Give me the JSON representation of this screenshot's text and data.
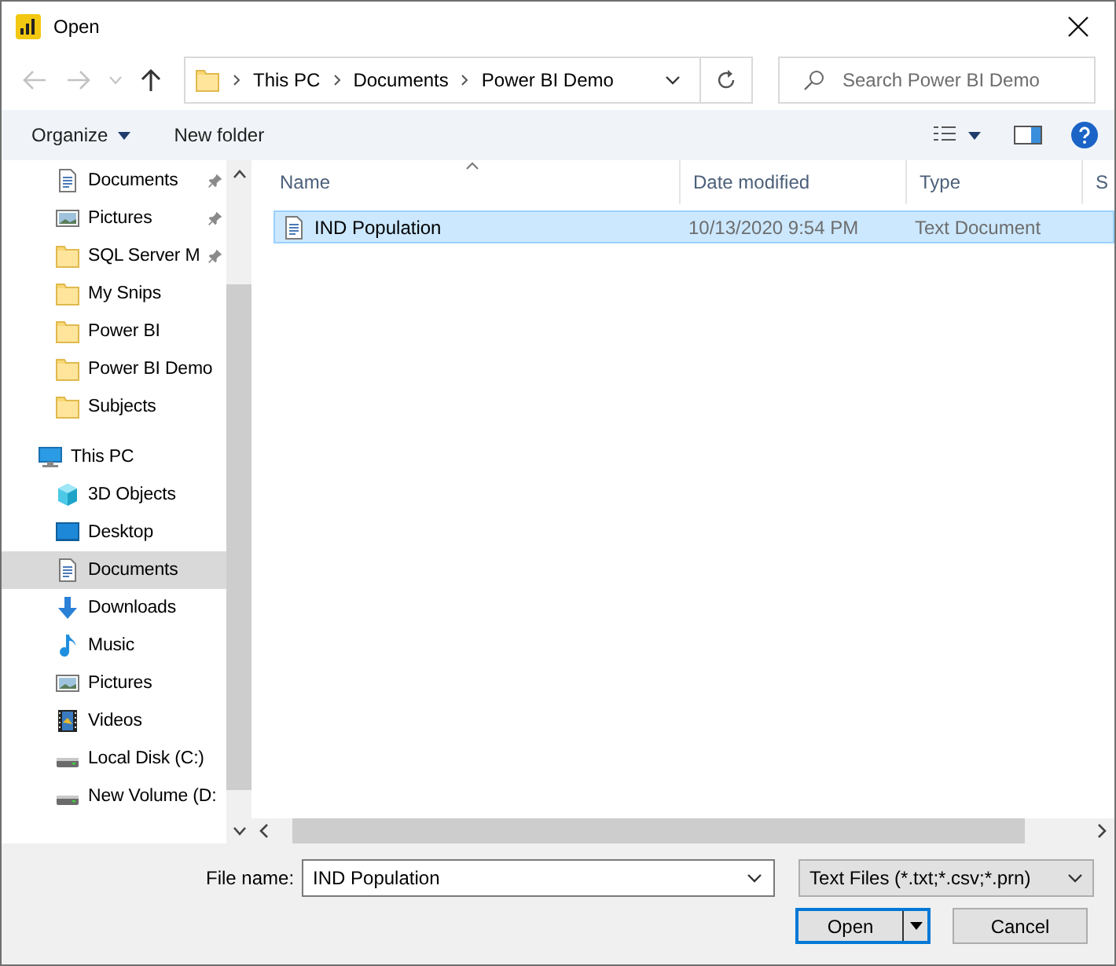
{
  "window": {
    "title": "Open"
  },
  "address": {
    "path": [
      "This PC",
      "Documents",
      "Power BI Demo"
    ]
  },
  "search": {
    "placeholder": "Search Power BI Demo"
  },
  "toolbar": {
    "organize": "Organize",
    "new_folder": "New folder"
  },
  "sidebar": {
    "quick_access": [
      {
        "label": "Documents",
        "kind": "document",
        "pinned": true,
        "selected": false
      },
      {
        "label": "Pictures",
        "kind": "pictures",
        "pinned": true,
        "selected": false
      },
      {
        "label": "SQL Server M",
        "kind": "folder",
        "pinned": true,
        "selected": false
      },
      {
        "label": "My Snips",
        "kind": "folder",
        "pinned": false,
        "selected": false
      },
      {
        "label": "Power BI",
        "kind": "folder",
        "pinned": false,
        "selected": false
      },
      {
        "label": "Power BI Demo",
        "kind": "folder",
        "pinned": false,
        "selected": false
      },
      {
        "label": "Subjects",
        "kind": "folder",
        "pinned": false,
        "selected": false
      }
    ],
    "this_pc": {
      "label": "This PC",
      "kind": "pc",
      "selected": false,
      "children": [
        {
          "label": "3D Objects",
          "kind": "cube",
          "selected": false
        },
        {
          "label": "Desktop",
          "kind": "desktop",
          "selected": false
        },
        {
          "label": "Documents",
          "kind": "document",
          "selected": true
        },
        {
          "label": "Downloads",
          "kind": "download",
          "selected": false
        },
        {
          "label": "Music",
          "kind": "music",
          "selected": false
        },
        {
          "label": "Pictures",
          "kind": "pictures",
          "selected": false
        },
        {
          "label": "Videos",
          "kind": "videos",
          "selected": false
        },
        {
          "label": "Local Disk (C:)",
          "kind": "drive",
          "selected": false
        },
        {
          "label": "New Volume (D:",
          "kind": "drive",
          "selected": false
        }
      ]
    }
  },
  "columns": [
    {
      "label": "Name",
      "sorted": true
    },
    {
      "label": "Date modified",
      "sorted": false
    },
    {
      "label": "Type",
      "sorted": false
    },
    {
      "label": "S",
      "sorted": false
    }
  ],
  "files": [
    {
      "name": "IND Population",
      "date": "10/13/2020 9:54 PM",
      "type": "Text Document",
      "selected": true
    }
  ],
  "file_name": {
    "label": "File name:",
    "value": "IND Population"
  },
  "file_type": {
    "value": "Text Files (*.txt;*.csv;*.prn)"
  },
  "buttons": {
    "open": "Open",
    "cancel": "Cancel"
  }
}
